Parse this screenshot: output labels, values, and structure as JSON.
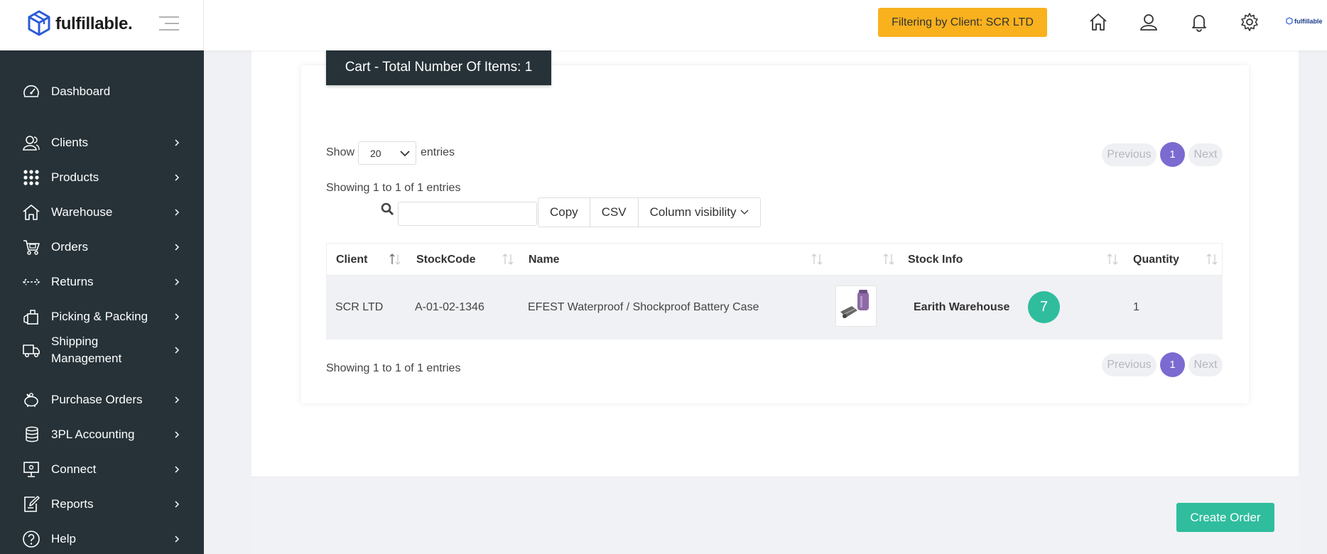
{
  "brand": {
    "name": "fulfillable.",
    "mini_logo": "fulfillable"
  },
  "topbar": {
    "filter_label": "Filtering by Client: SCR LTD",
    "icons": [
      "home-icon",
      "user-icon",
      "bell-icon",
      "gear-icon"
    ]
  },
  "sidebar": {
    "items": [
      {
        "label": "Dashboard",
        "icon": "dashboard-icon"
      },
      {
        "label": "Clients",
        "icon": "users-icon"
      },
      {
        "label": "Products",
        "icon": "grid-icon"
      },
      {
        "label": "Warehouse",
        "icon": "home-icon"
      },
      {
        "label": "Orders",
        "icon": "cart-icon"
      },
      {
        "label": "Returns",
        "icon": "arrows-icon"
      },
      {
        "label": "Picking & Packing",
        "icon": "box-icon"
      },
      {
        "label": "Shipping Management",
        "icon": "truck-icon"
      },
      {
        "label": "Purchase Orders",
        "icon": "piggy-bank-icon"
      },
      {
        "label": "3PL Accounting",
        "icon": "coins-icon"
      },
      {
        "label": "Connect",
        "icon": "monitor-icon"
      },
      {
        "label": "Reports",
        "icon": "edit-icon"
      },
      {
        "label": "Help",
        "icon": "help-icon"
      }
    ]
  },
  "cart": {
    "title": "Cart - Total Number Of Items: 1",
    "show_label": "Show",
    "entries_label": "entries",
    "page_length": "20",
    "info_top": "Showing 1 to 1 of 1 entries",
    "info_bottom": "Showing 1 to 1 of 1 entries",
    "pager": {
      "previous": "Previous",
      "current": "1",
      "next": "Next"
    },
    "search_value": "",
    "buttons": {
      "copy": "Copy",
      "csv": "CSV",
      "colvis": "Column visibility"
    },
    "columns": [
      "Client",
      "StockCode",
      "Name",
      "",
      "Stock Info",
      "Quantity"
    ],
    "rows": [
      {
        "client": "SCR LTD",
        "stock_code": "A-01-02-1346",
        "name": "EFEST Waterproof / Shockproof Battery Case",
        "stock_warehouse": "Earith Warehouse",
        "stock_count": "7",
        "quantity": "1"
      }
    ]
  },
  "footer": {
    "create_order": "Create Order"
  },
  "colors": {
    "sidebar": "#263238",
    "accent": "#2fbd9e",
    "filter": "#f9b11e",
    "pager": "#7b6ad0"
  }
}
